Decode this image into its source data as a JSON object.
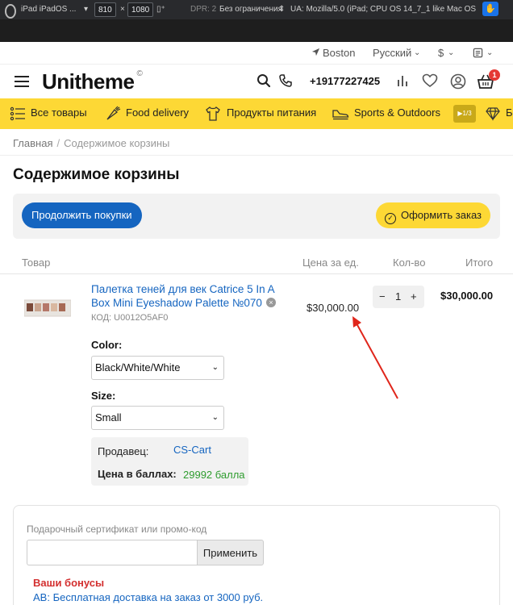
{
  "devtools": {
    "device": "iPad iPadOS ...",
    "width": "810",
    "times": "×",
    "height": "1080",
    "dpr": "DPR: 2",
    "throttle": "Без ограничения",
    "ua": "UA: Mozilla/5.0 (iPad; CPU OS 14_7_1 like Mac OS X) Ap"
  },
  "topbar": {
    "city": "Boston",
    "language": "Русский",
    "currency": "$"
  },
  "header": {
    "logo": "Unitheme",
    "logo_mark": "©",
    "phone": "+19177227425",
    "cart_count": "1"
  },
  "categories": [
    {
      "label": "Все товары",
      "icon": "list-icon"
    },
    {
      "label": "Food delivery",
      "icon": "carrot-icon"
    },
    {
      "label": "Продукты питания",
      "icon": "tshirt-icon"
    },
    {
      "label": "Sports & Outdoors",
      "icon": "sneaker-icon"
    },
    {
      "label": "Б",
      "icon": "diamond-icon"
    }
  ],
  "category_pager": "1/3",
  "breadcrumb": {
    "home": "Главная",
    "separator": "/",
    "current": "Содержимое корзины"
  },
  "page_title": "Содержимое корзины",
  "buttons": {
    "continue": "Продолжить покупки",
    "checkout": "Оформить заказ"
  },
  "table_headers": {
    "product": "Товар",
    "unit_price": "Цена за ед.",
    "qty": "Кол-во",
    "total": "Итого"
  },
  "item": {
    "name": "Палетка теней для век Catrice 5 In A Box Mini Eyeshadow Palette №070",
    "sku": "КОД: U0012O5AF0",
    "price": "$30,000.00",
    "quantity": "1",
    "minus": "−",
    "plus": "+",
    "subtotal": "$30,000.00",
    "options": [
      {
        "label": "Color:",
        "value": "Black/White/White"
      },
      {
        "label": "Size:",
        "value": "Small"
      }
    ],
    "vendor_label": "Продавец:",
    "vendor": "CS-Cart",
    "points_label": "Цена в баллах:",
    "points": "29992 балла"
  },
  "gift": {
    "label": "Подарочный сертификат или промо-код",
    "input_value": "",
    "apply": "Применить",
    "bonus_title": "Ваши бонусы",
    "bonus_text": "AB: Бесплатная доставка на заказ от 3000 руб."
  },
  "colors": {
    "accent_yellow": "#fdd835",
    "brand_blue": "#1565c0",
    "annotation_red": "#e0261b",
    "bonus_red": "#d32f2f",
    "points_green": "#2e9c2e"
  }
}
